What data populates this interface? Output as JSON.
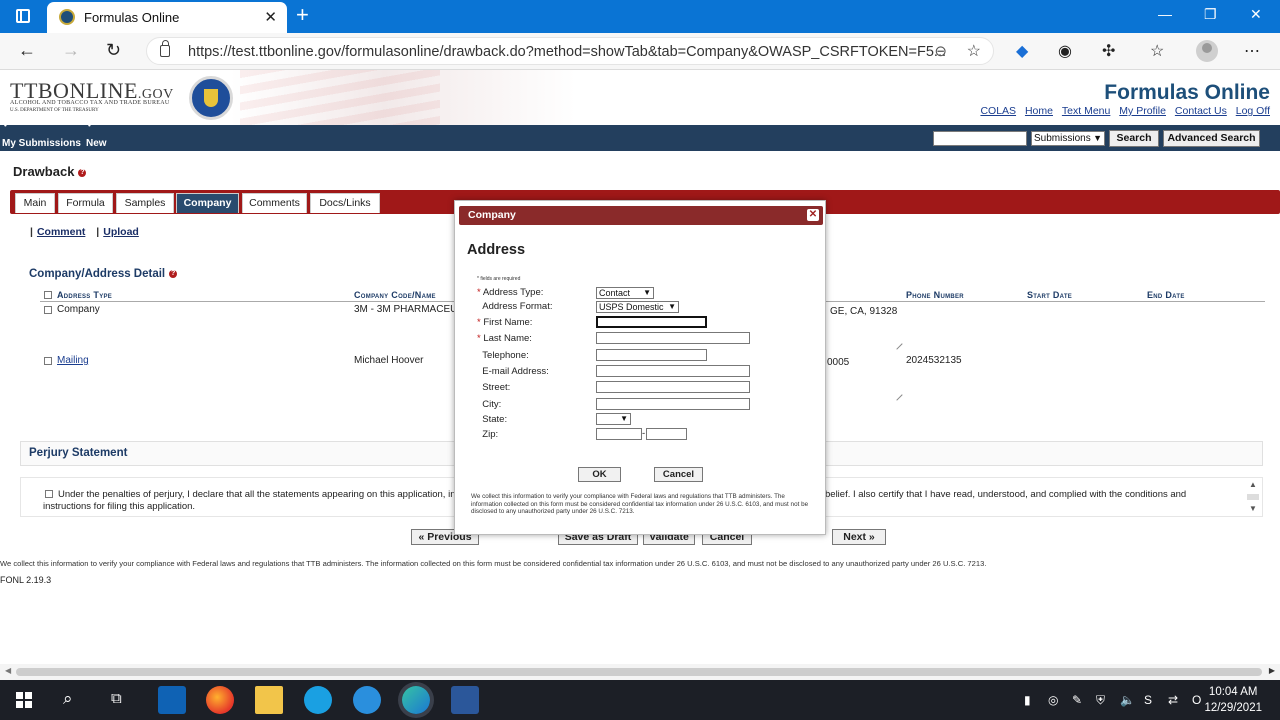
{
  "browser": {
    "tab_title": "Formulas Online",
    "url": "https://test.ttbonline.gov/formulasonline/drawback.do?method=showTab&tab=Company&OWASP_CSRFTOKEN=F5..."
  },
  "header": {
    "logo_text": "TTBONLINE",
    "logo_suffix": ".GOV",
    "logo_sub1": "ALCOHOL AND TOBACCO TAX AND TRADE BUREAU",
    "logo_sub2": "U.S. DEPARTMENT OF THE TREASURY",
    "app_title": "Formulas Online",
    "links": [
      "COLAS",
      "Home",
      "Text Menu",
      "My Profile",
      "Contact Us",
      "Log Off"
    ]
  },
  "navbar": {
    "my_submissions": "My Submissions",
    "new": "New",
    "search_select": "Submissions",
    "search_button": "Search",
    "advanced_search_button": "Advanced Search"
  },
  "page": {
    "title": "Drawback",
    "tabs": [
      "Main",
      "Formula",
      "Samples",
      "Company",
      "Comments",
      "Docs/Links"
    ],
    "active_tab": "Company",
    "sublinks": [
      "Comment",
      "Upload"
    ],
    "section_title": "Company/Address Detail",
    "columns": [
      "Address Type",
      "Company Code/Name",
      "Phone Number",
      "Start Date",
      "End Date"
    ],
    "rows": [
      {
        "type": "Company",
        "company": "3M - 3M PHARMACEUT",
        "address_tail": "GE, CA, 91328",
        "phone": ""
      },
      {
        "type": "Mailing",
        "company": "Michael Hoover",
        "address_tail": "0005",
        "phone": "2024532135"
      }
    ],
    "perjury_title": "Perjury Statement",
    "perjury_text_1": "Under the penalties of perjury, I declare that all the statements appearing on this application, in",
    "perjury_text_2": "belief. I also certify that I have read, understood, and complied with the conditions and",
    "perjury_text_3": "instructions for filing this application.",
    "buttons": {
      "previous": "« Previous",
      "save_draft": "Save as Draft",
      "validate": "Validate",
      "cancel": "Cancel",
      "next": "Next »"
    },
    "footer_note": "We collect this information to verify your compliance with Federal laws and regulations that TTB administers. The information collected on this form must be considered confidential tax information under 26 U.S.C. 6103, and must not be disclosed to any unauthorized party under 26 U.S.C. 7213.",
    "version": "FONL 2.19.3"
  },
  "modal": {
    "title": "Company",
    "heading": "Address",
    "required_note": "* fields are required",
    "fields": {
      "address_type": {
        "label": "Address Type:",
        "value": "Contact"
      },
      "address_format": {
        "label": "Address Format:",
        "value": "USPS Domestic"
      },
      "first_name": {
        "label": "First Name:"
      },
      "last_name": {
        "label": "Last Name:"
      },
      "telephone": {
        "label": "Telephone:"
      },
      "email": {
        "label": "E-mail Address:"
      },
      "street": {
        "label": "Street:"
      },
      "city": {
        "label": "City:"
      },
      "state": {
        "label": "State:",
        "value": ""
      },
      "zip": {
        "label": "Zip:"
      }
    },
    "ok_button": "OK",
    "cancel_button": "Cancel",
    "footer": "We collect this information to verify your compliance with Federal laws and regulations that TTB administers. The information collected on this form must be considered confidential tax information under 26 U.S.C. 6103, and must not be disclosed to any unauthorized party under 26 U.S.C. 7213."
  },
  "taskbar": {
    "time": "10:04 AM",
    "date": "12/29/2021"
  },
  "colors": {
    "tab_bar_red": "#a01818",
    "navbar_navy": "#233f5e",
    "browser_blue": "#0a74d4",
    "modal_header": "#8a2a2a"
  }
}
